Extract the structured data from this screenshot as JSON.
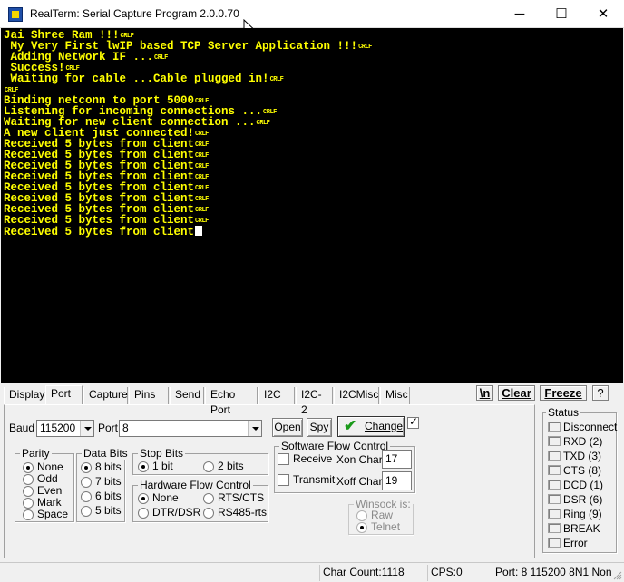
{
  "window": {
    "title": "RealTerm: Serial Capture Program 2.0.0.70",
    "min_glyph": "─",
    "max_glyph": "☐",
    "close_glyph": "✕"
  },
  "terminal": {
    "crlf_marker": "CRLF",
    "lines": [
      {
        "text": "Jai Shree Ram !!!",
        "crlf": true
      },
      {
        "text": " My Very First lwIP based TCP Server Application !!!",
        "crlf": true
      },
      {
        "text": " Adding Network IF ...",
        "crlf": true
      },
      {
        "text": " Success!",
        "crlf": true
      },
      {
        "text": " Waiting for cable ...Cable plugged in!",
        "crlf": true
      },
      {
        "text": "",
        "crlf": true
      },
      {
        "text": "Binding netconn to port 5000",
        "crlf": true
      },
      {
        "text": "Listening for incoming connections ...",
        "crlf": true
      },
      {
        "text": "Waiting for new client connection ...",
        "crlf": true
      },
      {
        "text": "A new client just connected!",
        "crlf": true
      },
      {
        "text": "Received 5 bytes from client",
        "crlf": true
      },
      {
        "text": "Received 5 bytes from client",
        "crlf": true
      },
      {
        "text": "Received 5 bytes from client",
        "crlf": true
      },
      {
        "text": "Received 5 bytes from client",
        "crlf": true
      },
      {
        "text": "Received 5 bytes from client",
        "crlf": true
      },
      {
        "text": "Received 5 bytes from client",
        "crlf": true
      },
      {
        "text": "Received 5 bytes from client",
        "crlf": true
      },
      {
        "text": "Received 5 bytes from client",
        "crlf": true
      },
      {
        "text": "Received 5 bytes from client",
        "crlf": false
      }
    ],
    "fg_color": "#ffff00",
    "bg_color": "#000000"
  },
  "tabs": [
    "Display",
    "Port",
    "Capture",
    "Pins",
    "Send",
    "Echo Port",
    "I2C",
    "I2C-2",
    "I2CMisc",
    "Misc"
  ],
  "active_tab": "Port",
  "top_buttons": {
    "newline": "\\n",
    "clear": "Clear",
    "freeze": "Freeze",
    "help": "?"
  },
  "port_panel": {
    "baud_label": "Baud",
    "baud_value": "115200",
    "port_label": "Port",
    "port_value": "8",
    "open_button": "Open",
    "spy_button": "Spy",
    "change_button": "Change",
    "parity": {
      "title": "Parity",
      "options": [
        "None",
        "Odd",
        "Even",
        "Mark",
        "Space"
      ],
      "selected": "None"
    },
    "data_bits": {
      "title": "Data Bits",
      "options": [
        "8 bits",
        "7 bits",
        "6 bits",
        "5 bits"
      ],
      "selected": "8 bits"
    },
    "stop_bits": {
      "title": "Stop Bits",
      "options": [
        "1 bit",
        "2 bits"
      ],
      "selected": "1 bit"
    },
    "hw_flow": {
      "title": "Hardware Flow Control",
      "options": [
        "None",
        "RTS/CTS",
        "DTR/DSR",
        "RS485-rts"
      ],
      "selected": "None"
    },
    "sw_flow": {
      "title": "Software Flow Control",
      "receive_label": "Receive",
      "transmit_label": "Transmit",
      "xon_label": "Xon Char:",
      "xon_value": "17",
      "xoff_label": "Xoff Char:",
      "xoff_value": "19"
    },
    "winsock": {
      "title": "Winsock is:",
      "options": [
        "Raw",
        "Telnet"
      ],
      "selected": "Telnet"
    }
  },
  "status": {
    "title": "Status",
    "items": [
      "Disconnect",
      "RXD (2)",
      "TXD (3)",
      "CTS (8)",
      "DCD (1)",
      "DSR (6)",
      "Ring (9)",
      "BREAK",
      "Error"
    ]
  },
  "statusbar": {
    "char_count": "Char Count:1118",
    "cps": "CPS:0",
    "port_info": "Port: 8 115200 8N1 Non"
  }
}
